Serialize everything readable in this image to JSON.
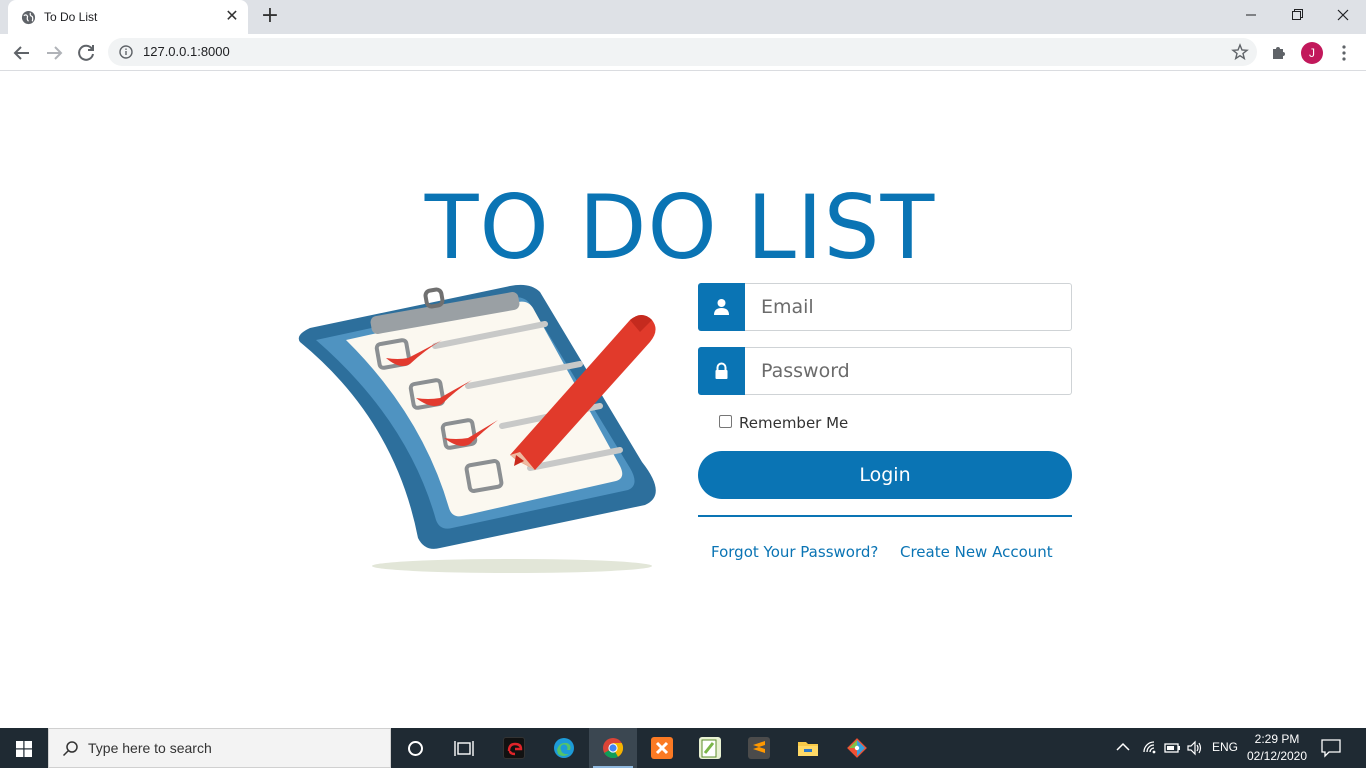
{
  "browser": {
    "tab_title": "To Do List",
    "url": "127.0.0.1:8000",
    "avatar_initial": "J"
  },
  "login": {
    "heading": "TO DO LIST",
    "email_placeholder": "Email",
    "password_placeholder": "Password",
    "remember_label": "Remember Me",
    "remember_checked": false,
    "login_label": "Login",
    "forgot_link": "Forgot Your Password?",
    "create_link": "Create New Account",
    "accent_color": "#0a74b4"
  },
  "taskbar": {
    "search_placeholder": "Type here to search",
    "language": "ENG",
    "time": "2:29 PM",
    "date": "02/12/2020",
    "apps": [
      "cortana-icon",
      "task-view-icon",
      "garena-icon",
      "edge-icon",
      "chrome-icon",
      "xampp-icon",
      "notepad-plus-icon",
      "sublime-text-icon",
      "file-explorer-icon",
      "git-icon"
    ]
  }
}
